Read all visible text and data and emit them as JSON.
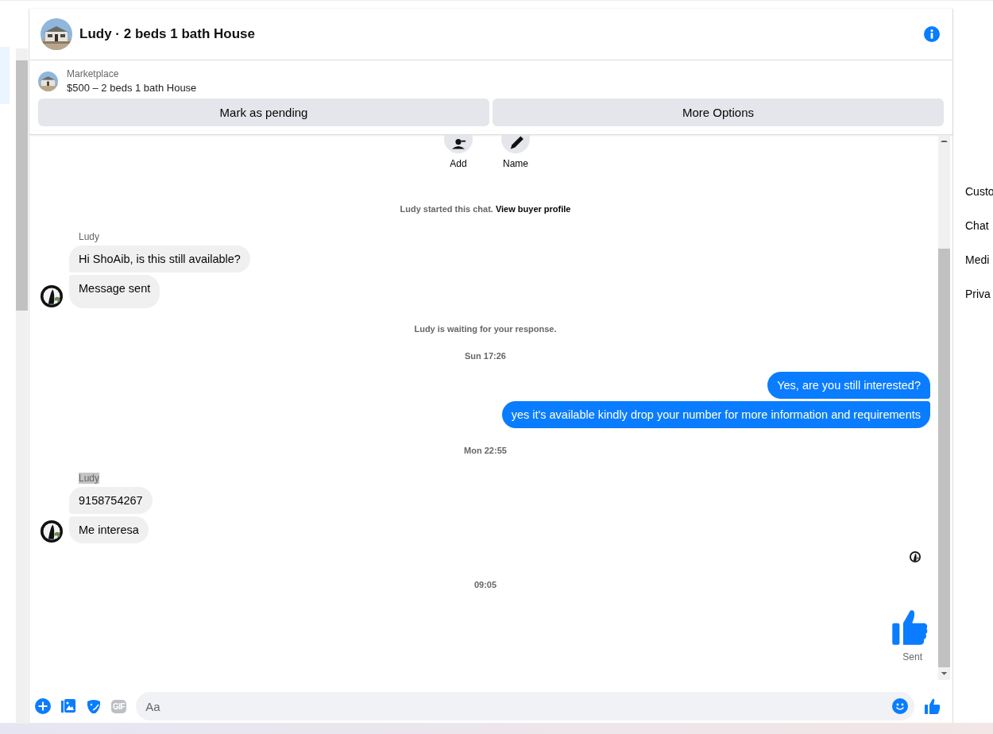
{
  "header": {
    "title": "Ludy · 2 beds 1 bath House"
  },
  "listing": {
    "source": "Marketplace",
    "title": "$500 – 2 beds 1 bath House"
  },
  "listing_actions": [
    "Mark as pending",
    "More Options"
  ],
  "profile_actions": [
    {
      "kind": "add",
      "label": "Add"
    },
    {
      "kind": "name",
      "label": "Name"
    }
  ],
  "conversation": [
    {
      "kind": "system",
      "text": "Ludy started this chat.",
      "link": "View buyer profile"
    },
    {
      "kind": "incoming",
      "sender": "Ludy",
      "sender_highlighted": false,
      "messages": [
        "Hi ShoAib, is this still available?",
        "Message sent"
      ]
    },
    {
      "kind": "system",
      "text": "Ludy is waiting for your response."
    },
    {
      "kind": "time",
      "text": "Sun 17:26"
    },
    {
      "kind": "outgoing",
      "messages": [
        "Yes, are you still interested?",
        "yes it's available kindly drop your number for more information and requirements"
      ]
    },
    {
      "kind": "time",
      "text": "Mon 22:55"
    },
    {
      "kind": "incoming",
      "sender": "Ludy",
      "sender_highlighted": true,
      "messages": [
        "9158754267",
        "Me interesa"
      ]
    },
    {
      "kind": "seen"
    },
    {
      "kind": "time",
      "text": "09:05"
    },
    {
      "kind": "like",
      "status": "Sent"
    }
  ],
  "composer": {
    "placeholder": "Aa",
    "gif_label": "GIF"
  },
  "right_panel": {
    "items": [
      "Custo",
      "Chat",
      "Medi",
      "Priva"
    ]
  }
}
